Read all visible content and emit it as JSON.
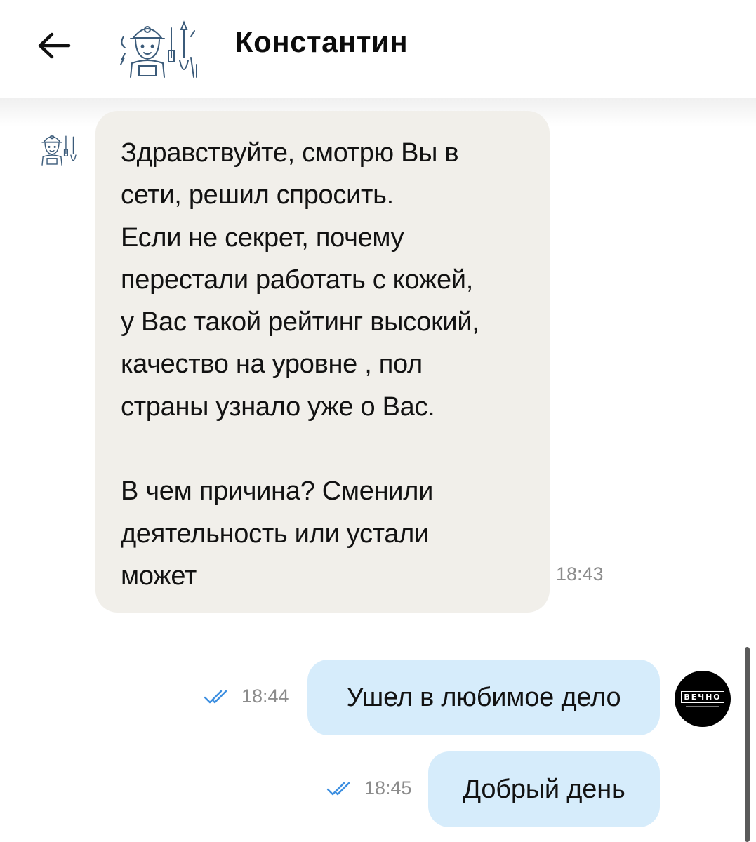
{
  "header": {
    "contact_name": "Константин",
    "back_icon": "arrow-left-icon",
    "avatar_icon": "electrician-avatar-icon"
  },
  "messages": [
    {
      "direction": "incoming",
      "text": "Здравствуйте, смотрю Вы в\nсети, решил спросить.\nЕсли не секрет, почему\nперестали работать с кожей,\nу Вас такой рейтинг высокий,\nкачество на уровне , пол\nстраны узнало уже о Вас.\n\nВ чем причина? Сменили\nдеятельность или устали\nможет",
      "time": "18:43"
    },
    {
      "direction": "outgoing",
      "text": "Ушел в любимое дело",
      "time": "18:44",
      "status_icon": "double-check-icon"
    },
    {
      "direction": "outgoing",
      "text": "Добрый день",
      "time": "18:45",
      "status_icon": "double-check-icon"
    }
  ],
  "my_avatar": {
    "label": "ВЕЧНО"
  },
  "colors": {
    "incoming_bubble": "#f1efea",
    "outgoing_bubble": "#d6ecfb",
    "read_check": "#3d8fe0",
    "time_text": "#8c8c8c"
  }
}
